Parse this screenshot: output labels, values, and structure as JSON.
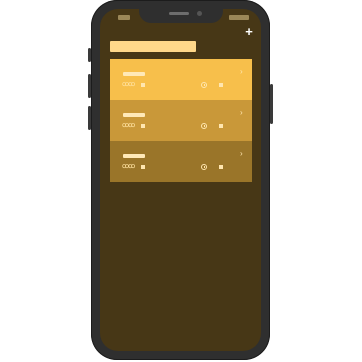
{
  "device": {
    "frame_color": "#2f2f2f",
    "screen_color": "#473716"
  },
  "header": {
    "add_icon": "+",
    "title_bar_color": "#ffd88a"
  },
  "list": {
    "rows": [
      {
        "color": "#f7bf4b",
        "people_icon": "ꝏꝏ",
        "chevron": "›"
      },
      {
        "color": "#c99839",
        "people_icon": "ꝏꝏ",
        "chevron": "›"
      },
      {
        "color": "#9a7529",
        "people_icon": "ꝏꝏ",
        "chevron": "›"
      }
    ]
  }
}
